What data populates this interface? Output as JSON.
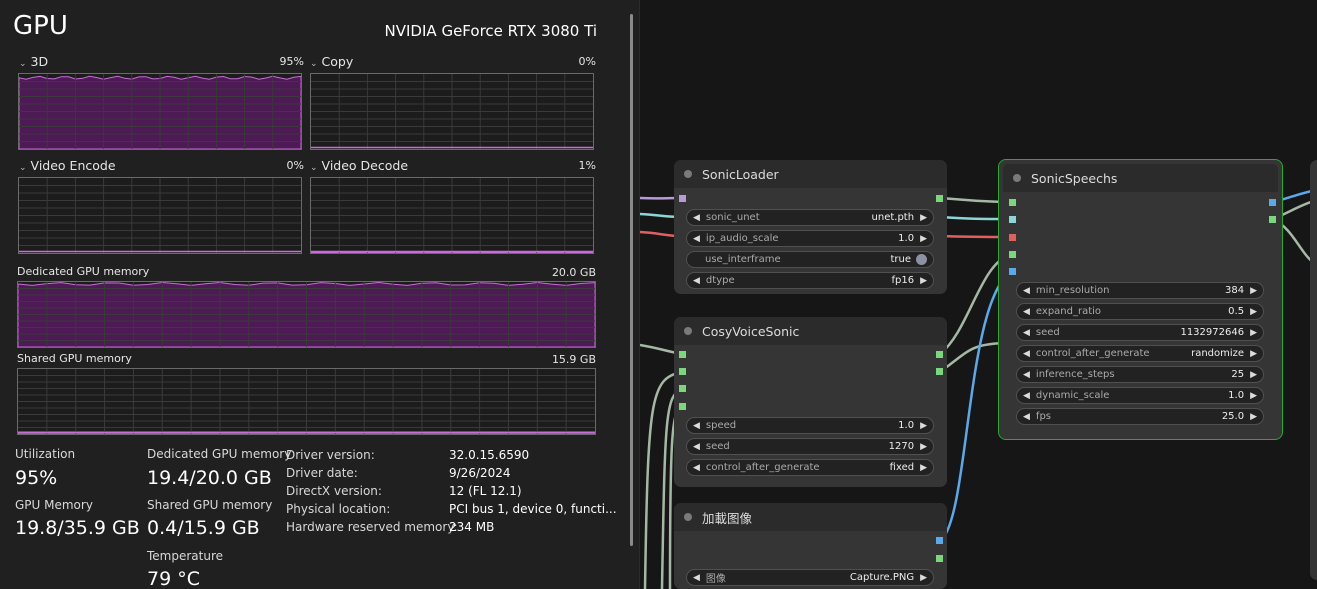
{
  "taskmanager": {
    "title": "GPU",
    "gpu_name": "NVIDIA GeForce RTX 3080 Ti",
    "graphs": [
      {
        "label": "3D",
        "percent": "95%",
        "level": 0.95
      },
      {
        "label": "Copy",
        "percent": "0%",
        "level": 0.0
      },
      {
        "label": "Video Encode",
        "percent": "0%",
        "level": 0.0
      },
      {
        "label": "Video Decode",
        "percent": "1%",
        "level": 0.01
      }
    ],
    "dedicated": {
      "label": "Dedicated GPU memory",
      "value": "20.0 GB",
      "level": 0.97
    },
    "shared": {
      "label": "Shared GPU memory",
      "value": "15.9 GB",
      "level": 0.03
    },
    "stats": {
      "utilization_label": "Utilization",
      "utilization_value": "95%",
      "gpu_memory_label": "GPU Memory",
      "gpu_memory_value": "19.8/35.9 GB",
      "dedicated_label": "Dedicated GPU memory",
      "dedicated_value": "19.4/20.0 GB",
      "shared_label": "Shared GPU memory",
      "shared_value": "0.4/15.9 GB",
      "temperature_label": "Temperature",
      "temperature_value": "79 °C"
    },
    "info": [
      {
        "label": "Driver version:",
        "value": "32.0.15.6590"
      },
      {
        "label": "Driver date:",
        "value": "9/26/2024"
      },
      {
        "label": "DirectX version:",
        "value": "12 (FL 12.1)"
      },
      {
        "label": "Physical location:",
        "value": "PCI bus 1, device 0, functi..."
      },
      {
        "label": "Hardware reserved memory:",
        "value": "234 MB"
      }
    ],
    "colors": {
      "accent": "#c86dd7",
      "fill": "#4d1a55"
    }
  },
  "nodes": {
    "sonic_loader": {
      "title": "SonicLoader",
      "widgets": [
        {
          "name": "sonic_unet",
          "value": "unet.pth"
        },
        {
          "name": "ip_audio_scale",
          "value": "1.0"
        },
        {
          "name": "use_interframe",
          "value": "true"
        },
        {
          "name": "dtype",
          "value": "fp16"
        }
      ]
    },
    "cosy_voice": {
      "title": "CosyVoiceSonic",
      "widgets": [
        {
          "name": "speed",
          "value": "1.0"
        },
        {
          "name": "seed",
          "value": "1270"
        },
        {
          "name": "control_after_generate",
          "value": "fixed"
        }
      ]
    },
    "load_image": {
      "title": "加載图像",
      "widgets": [
        {
          "name": "图像",
          "value": "Capture.PNG"
        }
      ]
    },
    "sonic_speechs": {
      "title": "SonicSpeechs",
      "widgets": [
        {
          "name": "min_resolution",
          "value": "384"
        },
        {
          "name": "expand_ratio",
          "value": "0.5"
        },
        {
          "name": "seed",
          "value": "1132972646"
        },
        {
          "name": "control_after_generate",
          "value": "randomize"
        },
        {
          "name": "inference_steps",
          "value": "25"
        },
        {
          "name": "dynamic_scale",
          "value": "1.0"
        },
        {
          "name": "fps",
          "value": "25.0"
        }
      ]
    }
  }
}
